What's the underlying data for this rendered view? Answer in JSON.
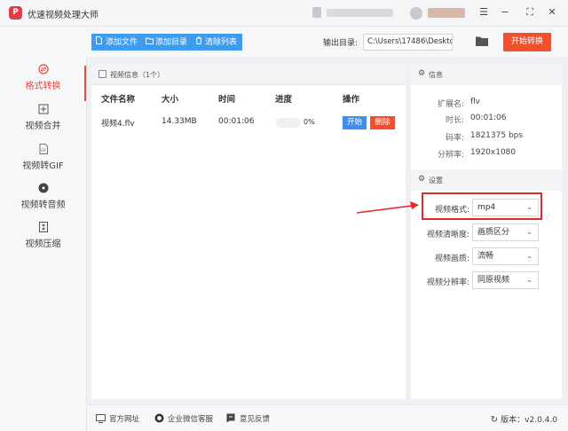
{
  "window": {
    "title": "优速视频处理大师",
    "controls": {
      "menu": "☰",
      "minimize": "−",
      "maximize": "⛶",
      "close": "✕"
    }
  },
  "toolbar": {
    "add_file": "添加文件",
    "add_folder": "添加目录",
    "clear_list": "清除列表",
    "output_label": "输出目录:",
    "output_path": "C:\\Users\\17486\\Deskto",
    "start_all": "开始转换"
  },
  "sidebar": {
    "items": [
      {
        "label": "格式转换",
        "icon": "convert-icon",
        "active": true
      },
      {
        "label": "视频合并",
        "icon": "merge-icon",
        "active": false
      },
      {
        "label": "视频转GIF",
        "icon": "gif-icon",
        "active": false
      },
      {
        "label": "视频转音频",
        "icon": "audio-icon",
        "active": false
      },
      {
        "label": "视频压缩",
        "icon": "compress-icon",
        "active": false
      }
    ]
  },
  "file_panel": {
    "header": "视频信息（1个）",
    "columns": [
      "文件名称",
      "大小",
      "时间",
      "进度",
      "操作"
    ],
    "rows": [
      {
        "name": "视频4.flv",
        "size": "14.33MB",
        "time": "00:01:06",
        "progress_pct": 0,
        "progress_label": "0%",
        "start": "开始",
        "delete": "删除"
      }
    ]
  },
  "info_panel": {
    "header": "信息",
    "fields": [
      {
        "label": "扩展名:",
        "value": "flv"
      },
      {
        "label": "时长:",
        "value": "00:01:06"
      },
      {
        "label": "码率:",
        "value": "1821375 bps"
      },
      {
        "label": "分辨率:",
        "value": "1920x1080"
      }
    ]
  },
  "settings_panel": {
    "header": "设置",
    "fields": [
      {
        "label": "视频格式:",
        "value": "mp4"
      },
      {
        "label": "视频清晰度:",
        "value": "画质区分"
      },
      {
        "label": "视频画质:",
        "value": "流畅"
      },
      {
        "label": "视频分辨率:",
        "value": "同原视频"
      }
    ]
  },
  "footer": {
    "website": "官方网址",
    "wechat": "企业微信客服",
    "feedback": "意见反馈",
    "version": "版本：v2.0.4.0"
  },
  "colors": {
    "accent_blue": "#3d9cf0",
    "accent_red": "#f2502a",
    "highlight_red": "#e8262a"
  }
}
